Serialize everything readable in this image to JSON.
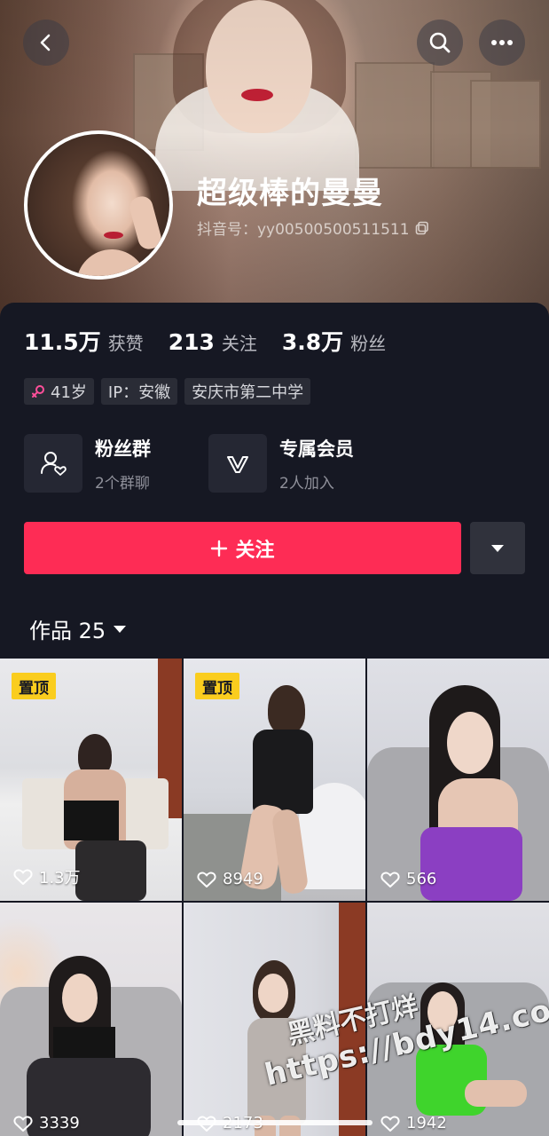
{
  "profile": {
    "name": "超级棒的曼曼",
    "douyin_id": "抖音号：yy00500500511511"
  },
  "stats": [
    {
      "value": "11.5万",
      "label": "获赞"
    },
    {
      "value": "213",
      "label": "关注"
    },
    {
      "value": "3.8万",
      "label": "粉丝"
    }
  ],
  "tags": {
    "age": "41岁",
    "ip": "IP：安徽",
    "school": "安庆市第二中学"
  },
  "features": {
    "fan_group": {
      "title": "粉丝群",
      "subtitle": "2个群聊"
    },
    "membership": {
      "title": "专属会员",
      "subtitle": "2人加入"
    }
  },
  "actions": {
    "follow_label": "关注"
  },
  "works": {
    "tab_label": "作品 25"
  },
  "videos": [
    {
      "pinned": "置顶",
      "likes": "1.3万"
    },
    {
      "pinned": "置顶",
      "likes": "8949"
    },
    {
      "pinned": "",
      "likes": "566"
    },
    {
      "pinned": "",
      "likes": "3339"
    },
    {
      "pinned": "",
      "likes": "2173"
    },
    {
      "pinned": "",
      "likes": "1942"
    }
  ],
  "watermark": {
    "line1": "黑料不打烊",
    "line2": "https://bdy14.co"
  },
  "colors": {
    "accent": "#fe2c55",
    "pin_badge": "#facd1e",
    "background": "#161823"
  }
}
